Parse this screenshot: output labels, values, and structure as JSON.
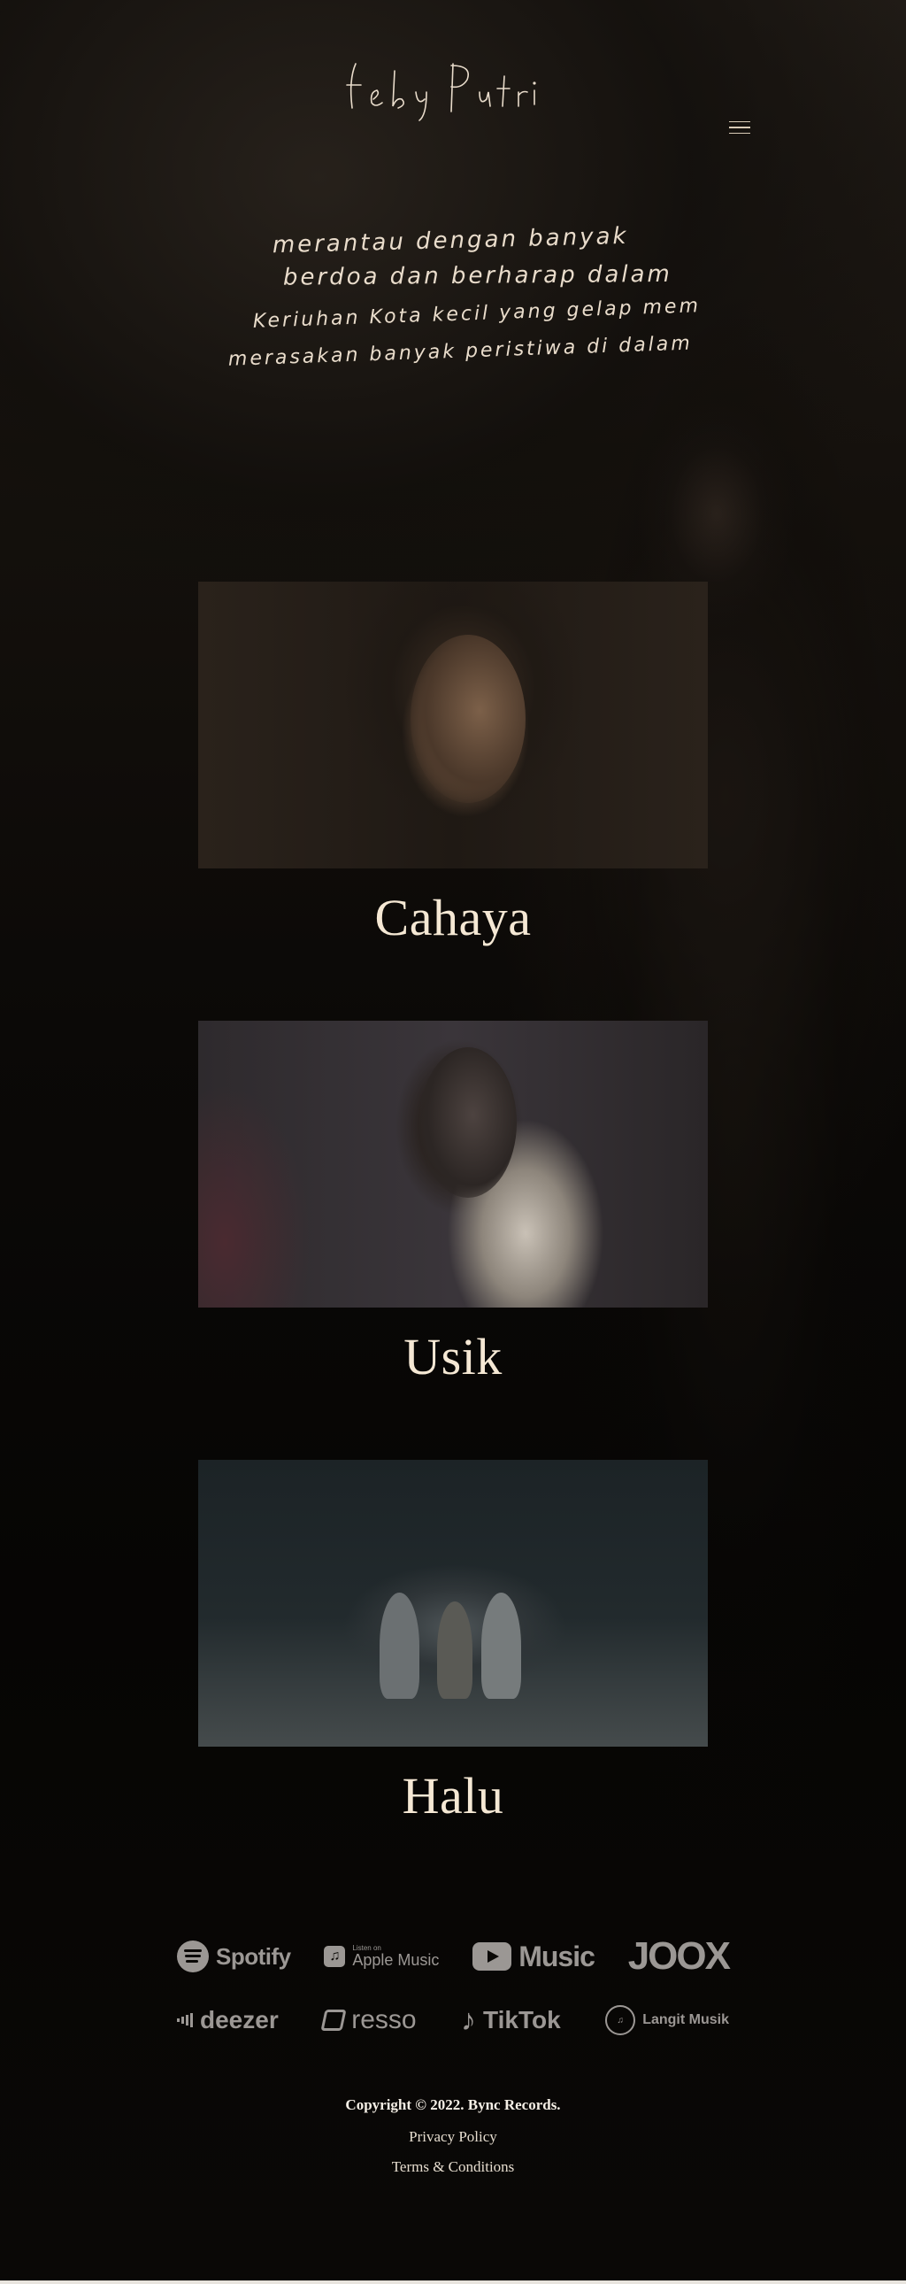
{
  "header": {
    "logo_text": "feby Putri",
    "menu_icon": "hamburger-menu-icon"
  },
  "poem": {
    "lines": [
      "merantau dengan banyak",
      "berdoa dan berharap dalam",
      "Keriuhan Kota kecil yang gelap memaksa",
      "merasakan banyak peristiwa di dalam diri"
    ]
  },
  "releases": [
    {
      "title": "Cahaya"
    },
    {
      "title": "Usik"
    },
    {
      "title": "Halu"
    }
  ],
  "streaming": {
    "row1": [
      {
        "name": "Spotify",
        "icon": "spotify-icon"
      },
      {
        "name": "Apple Music",
        "sub": "Listen on",
        "icon": "apple-music-icon"
      },
      {
        "name": "Music",
        "icon": "youtube-music-icon"
      },
      {
        "name": "JOOX",
        "icon": "joox-icon"
      }
    ],
    "row2": [
      {
        "name": "deezer",
        "icon": "deezer-icon"
      },
      {
        "name": "resso",
        "icon": "resso-icon"
      },
      {
        "name": "TikTok",
        "icon": "tiktok-icon"
      },
      {
        "name": "Langit Musik",
        "icon": "langit-musik-icon"
      }
    ]
  },
  "footer": {
    "copyright": "Copyright © 2022. Bync Records.",
    "privacy": "Privacy Policy",
    "terms": "Terms & Conditions"
  },
  "colors": {
    "text": "#f3e6d3",
    "logo_gray": "#9b9794",
    "background": "#050403"
  }
}
